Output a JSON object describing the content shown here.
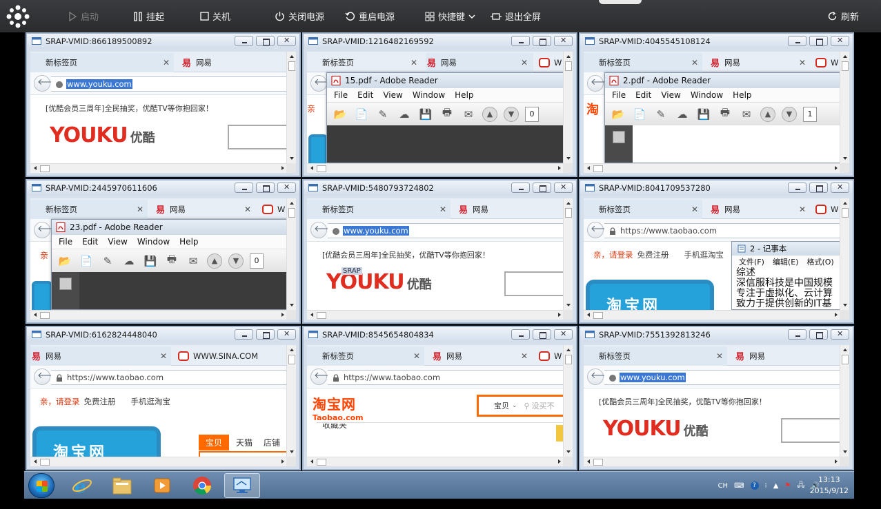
{
  "toolbar": {
    "start": "启动",
    "hang": "挂起",
    "shutdown": "关机",
    "power_off": "关闭电源",
    "restart_power": "重启电源",
    "shortcut": "快捷键",
    "exit_fullscreen": "退出全屏",
    "refresh": "刷新"
  },
  "panes": [
    {
      "vm": "SRAP-VMID:866189500892",
      "tabs": [
        "新标签页",
        "网易"
      ],
      "url": "www.youku.com",
      "banner": "[优酷会员三周年]全民抽奖，优酷TV等你抱回家！",
      "logo": "YOUKU",
      "logo_cn": "优酷"
    },
    {
      "vm": "SRAP-VMID:1216482169592",
      "tabs": [
        "新标签页",
        "网易",
        "W"
      ],
      "reader": {
        "title": "15.pdf - Adobe Reader",
        "menu": [
          "File",
          "Edit",
          "View",
          "Window",
          "Help"
        ],
        "page": "0"
      }
    },
    {
      "vm": "SRAP-VMID:4045545108124",
      "tabs": [
        "新标签页",
        "网易",
        "W"
      ],
      "reader": {
        "title": "2.pdf - Adobe Reader",
        "menu": [
          "File",
          "Edit",
          "View",
          "Window",
          "Help"
        ],
        "page": "1"
      }
    },
    {
      "vm": "SRAP-VMID:2445970611606",
      "tabs": [
        "新标签页",
        "网易",
        "W"
      ],
      "reader": {
        "title": "23.pdf - Adobe Reader",
        "menu": [
          "File",
          "Edit",
          "View",
          "Window",
          "Help"
        ],
        "page": "0"
      },
      "partial": "亲"
    },
    {
      "vm": "SRAP-VMID:5480793724802",
      "tabs": [
        "新标签页",
        "网易"
      ],
      "url": "www.youku.com",
      "banner": "[优酷会员三周年]全民抽奖，优酷TV等你抱回家！",
      "logo": "YOUKU",
      "logo_cn": "优酷",
      "overlay": "SRAP"
    },
    {
      "vm": "SRAP-VMID:8041709537280",
      "tabs": [
        "新标签页",
        "网易",
        "W"
      ],
      "url": "https://www.taobao.com",
      "login": "亲，请登录",
      "register": "免费注册",
      "mobile": "手机逛淘宝",
      "notepad": {
        "title": "2 - 记事本",
        "menu": [
          "文件(F)",
          "编辑(E)",
          "格式(O)"
        ],
        "lines": [
          "综述",
          "深信服科技是中国规模",
          "专注于虚拟化、云计算",
          "致力于提供创新的IT基"
        ]
      },
      "tile": "淘宝网"
    },
    {
      "vm": "SRAP-VMID:6162824448040",
      "tabs": [
        "网易",
        "WWW.SINA.COM"
      ],
      "url": "https://www.taobao.com",
      "login": "亲，请登录",
      "register": "免费注册",
      "mobile": "手机逛淘宝",
      "tile": "淘宝网",
      "nav": [
        "宝贝",
        "天猫",
        "店铺"
      ]
    },
    {
      "vm": "SRAP-VMID:8545654804834",
      "tabs": [
        "新标签页",
        "网易",
        "W"
      ],
      "url": "https://www.taobao.com",
      "logo": "淘宝网",
      "logo_sub": "Taobao.com",
      "search_cat": "宝贝",
      "search_ph": "没买不",
      "partial": "收藏夹"
    },
    {
      "vm": "SRAP-VMID:7551392813246",
      "tabs": [
        "新标签页",
        "网易"
      ],
      "url": "www.youku.com",
      "banner": "[优酷会员三周年]全民抽奖，优酷TV等你抱回家！",
      "logo": "YOUKU",
      "logo_cn": "优酷"
    }
  ],
  "taskbar": {
    "apps": [
      "windows-start",
      "internet-explorer",
      "file-explorer",
      "media-player",
      "chrome",
      "remote-desktop"
    ],
    "ime": "CH",
    "time": "13:13",
    "date": "2015/9/12"
  }
}
